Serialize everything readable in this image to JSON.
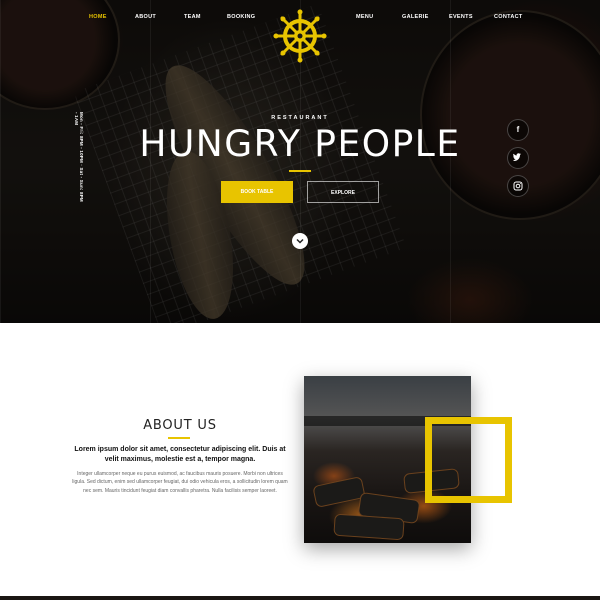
{
  "nav": {
    "left": [
      "HOME",
      "ABOUT",
      "TEAM",
      "BOOKING"
    ],
    "right": [
      "MENU",
      "GALERIE",
      "EVENTS",
      "CONTACT"
    ],
    "active": "HOME"
  },
  "logo": {
    "icon": "ship-wheel-icon",
    "color": "#e8c400"
  },
  "hero": {
    "hours": "Mon - Fri: 8PM - 10PM · Sat - Sun: 8PM - 1AM",
    "eyebrow": "RESTAURANT",
    "title": "HUNGRY PEOPLE",
    "book_label": "BOOK TABLE",
    "explore_label": "EXPLORE",
    "scroll_icon": "chevron-down-icon"
  },
  "social": {
    "facebook": "f",
    "twitter": "t",
    "instagram": "◎"
  },
  "about": {
    "title": "ABOUT US",
    "lead": "Lorem ipsum dolor sit amet, consectetur adipiscing elit. Duis at velit maximus, molestie est a, tempor magna.",
    "body": "Integer ullamcorper neque eu purus euismod, ac faucibus mauris posuere. Morbi non ultrices ligula. Sed dictum, enim sed ullamcorper feugiat, dui odio vehicula eros, a sollicitudin lorem quam nec sem. Mauris tincidunt feugiat diam convallis pharetra. Nulla facilisis semper laoreet."
  },
  "colors": {
    "accent": "#e8c400",
    "dark": "#15120f"
  }
}
